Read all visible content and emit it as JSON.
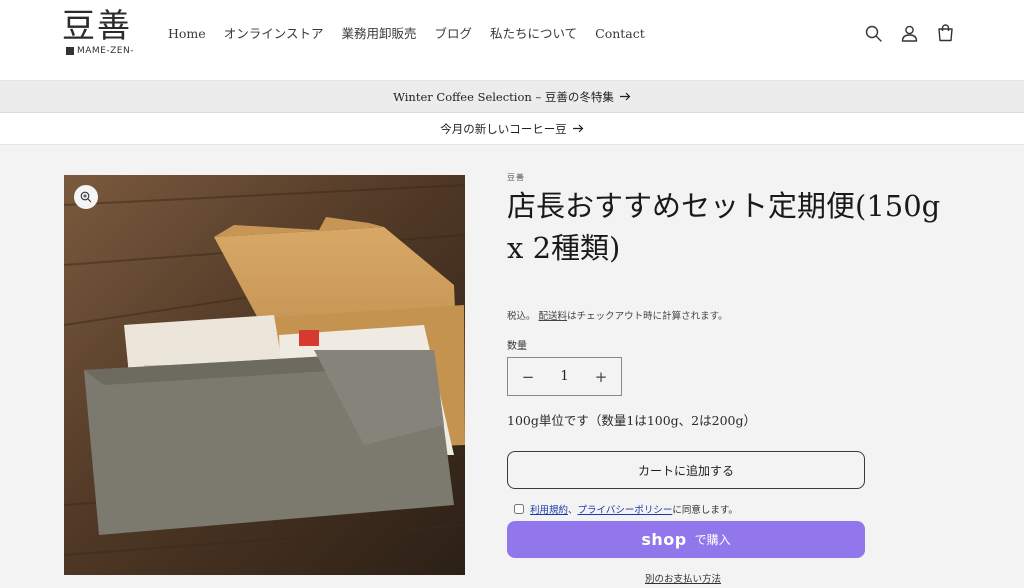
{
  "brand": {
    "logo_text": "豆善",
    "logo_sub": "MAME-ZEN-"
  },
  "nav": {
    "items": [
      "Home",
      "オンラインストア",
      "業務用卸販売",
      "ブログ",
      "私たちについて",
      "Contact"
    ]
  },
  "header_icons": [
    "search-icon",
    "account-icon",
    "cart-icon"
  ],
  "announcements": {
    "primary": "Winter Coffee Selection – 豆善の冬特集",
    "secondary": "今月の新しいコーヒー豆"
  },
  "product": {
    "vendor": "豆善",
    "title": "店長おすすめセット定期便(150g x 2種類)",
    "tax_prefix": "税込。",
    "tax_link": "配送料",
    "tax_suffix": "はチェックアウト時に計算されます。",
    "quantity_label": "数量",
    "quantity_value": "1",
    "quantity_minus": "−",
    "quantity_plus": "+",
    "unit_note": "100g単位です（数量1は100g、2は200g）",
    "add_to_cart": "カートに追加する",
    "terms_link1": "利用規約",
    "terms_sep": "、",
    "terms_link2": "プライバシーポリシー",
    "terms_suffix": "に同意します。",
    "shop_pay_logo": "shop",
    "shop_pay_text": "で購入",
    "alt_payment": "別のお支払い方法"
  },
  "colors": {
    "shop_pay": "#9277ec",
    "link": "#1a3aa8",
    "background": "#f3f3f3"
  }
}
